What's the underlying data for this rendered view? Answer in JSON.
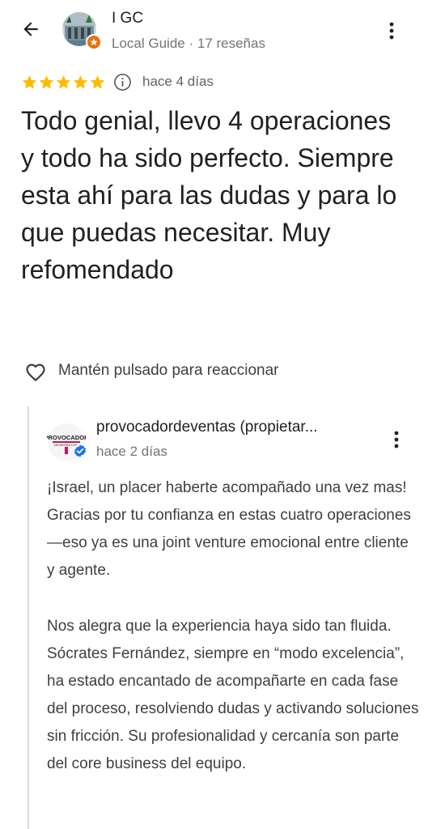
{
  "header": {
    "user_name": "I GC",
    "user_meta": "Local Guide · 17 reseñas"
  },
  "rating": {
    "stars": 5,
    "date": "hace 4 días",
    "star_color": "#fbbc04"
  },
  "review": {
    "text": "Todo genial, llevo 4 operaciones y todo ha sido perfecto. Siempre esta ahí para las dudas y para lo que puedas necesitar. Muy refomendado"
  },
  "reaction": {
    "label": "Mantén pulsado para reaccionar"
  },
  "owner_reply": {
    "logo_text_top": "PROVOCADOR",
    "logo_text_bottom": "DEVENTAS.COM",
    "name": "provocadordeventas (propietar...",
    "date": "hace 2 días",
    "paragraphs": [
      "¡Israel, un placer haberte acompañado una vez mas! Gracias por tu confianza en estas cuatro operaciones —eso ya es una joint venture emocional entre cliente y agente.",
      "Nos alegra que la experiencia haya sido tan fluida. Sócrates Fernández, siempre en “modo excelencia”, ha estado encantado de acompañarte en cada fase del proceso, resolviendo dudas y activando soluciones sin fricción. Su profesionalidad y cercanía son parte del core business del equipo."
    ],
    "verified_color": "#1a73e8"
  }
}
